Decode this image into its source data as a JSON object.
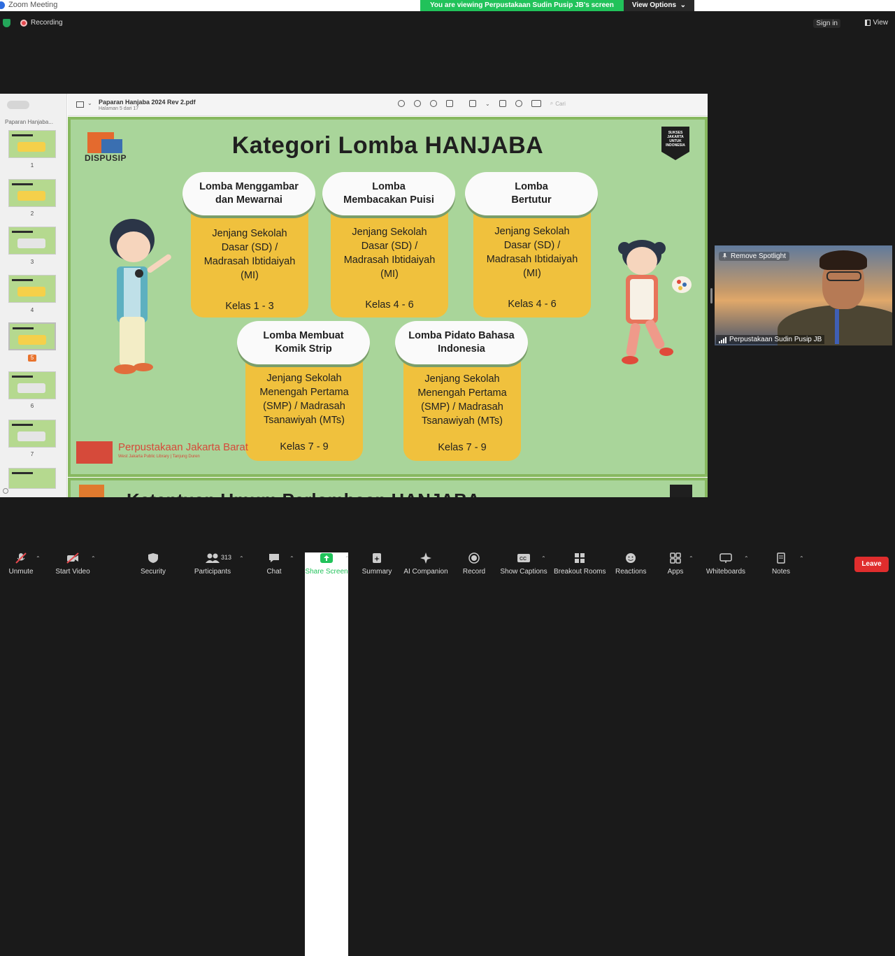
{
  "window": {
    "title": "Zoom Meeting"
  },
  "banner": {
    "message": "You are viewing Perpustakaan Sudin Pusip JB's screen",
    "options_label": "View Options"
  },
  "topbar": {
    "recording_label": "Recording",
    "signin_label": "Sign in",
    "view_label": "View"
  },
  "pdf": {
    "sidebar_title": "Paparan Hanjaba...",
    "doc_name": "Paparan Hanjaba 2024 Rev 2.pdf",
    "page_info": "Halaman 5 dari 17",
    "search_placeholder": "Cari",
    "thumbnails": [
      "1",
      "2",
      "3",
      "4",
      "5",
      "6",
      "7"
    ],
    "selected_page": "5"
  },
  "slide": {
    "dispusip_label": "DISPUSIP",
    "sukses_label": "SUKSES JAKARTA UNTUK INDONESIA",
    "title": "Kategori Lomba HANJABA",
    "cards": [
      {
        "title": "Lomba Menggambar dan Mewarnai",
        "level": "Jenjang Sekolah Dasar (SD) / Madrasah Ibtidaiyah (MI)",
        "grade": "Kelas 1 - 3"
      },
      {
        "title": "Lomba Membacakan Puisi",
        "level": "Jenjang Sekolah Dasar (SD) / Madrasah Ibtidaiyah (MI)",
        "grade": "Kelas 4 - 6"
      },
      {
        "title": "Lomba Bertutur",
        "level": "Jenjang Sekolah Dasar (SD) / Madrasah Ibtidaiyah (MI)",
        "grade": "Kelas 4 - 6"
      },
      {
        "title": "Lomba Membuat Komik Strip",
        "level": "Jenjang Sekolah Menengah Pertama (SMP) / Madrasah Tsanawiyah (MTs)",
        "grade": "Kelas 7 - 9"
      },
      {
        "title": "Lomba Pidato Bahasa Indonesia",
        "level": "Jenjang Sekolah Menengah Pertama (SMP) / Madrasah Tsanawiyah (MTs)",
        "grade": "Kelas 7 - 9"
      }
    ],
    "library_name": "Perpustakaan Jakarta Barat",
    "library_sub": "West Jakarta Public Library | Tanjung Duren",
    "next_title": "Ketentuan Umum Perlombaan HANJABA"
  },
  "video": {
    "spotlight_label": "Remove Spotlight",
    "participant_name": "Perpustakaan Sudin Pusip JB"
  },
  "controls": {
    "unmute": "Unmute",
    "start_video": "Start Video",
    "security": "Security",
    "participants": "Participants",
    "participants_count": "313",
    "chat": "Chat",
    "share_screen": "Share Screen",
    "summary": "Summary",
    "ai_companion": "AI Companion",
    "record": "Record",
    "show_captions": "Show Captions",
    "breakout_rooms": "Breakout Rooms",
    "reactions": "Reactions",
    "apps": "Apps",
    "whiteboards": "Whiteboards",
    "notes": "Notes",
    "leave": "Leave"
  },
  "colors": {
    "share_green": "#21c25a",
    "leave_red": "#e02d2d",
    "slide_green": "#a9d59a",
    "card_yellow": "#f0c13d"
  }
}
